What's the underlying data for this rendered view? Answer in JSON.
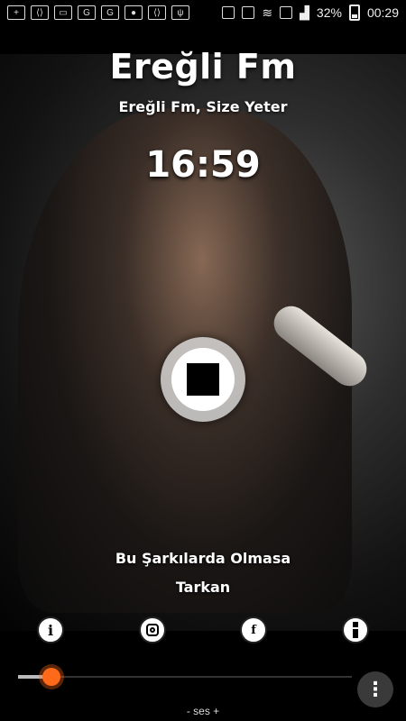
{
  "status_bar": {
    "battery_percent": "32%",
    "time": "00:29",
    "battery_level": 0.32
  },
  "station": {
    "name": "Ereğli Fm",
    "slogan": "Ereğli Fm, Size Yeter",
    "clock": "16:59"
  },
  "now_playing": {
    "song": "Bu Şarkılarda Olmasa",
    "artist": "Tarkan"
  },
  "controls": {
    "play_state_icon": "stop-icon",
    "volume_level": 0.1,
    "volume_label": "- ses +",
    "menu_glyph": "⋮"
  },
  "icons": [
    "info-icon",
    "instagram-icon",
    "facebook-icon",
    "more-icon"
  ],
  "colors": {
    "accent": "#ff6a1a",
    "text": "#ffffff"
  }
}
